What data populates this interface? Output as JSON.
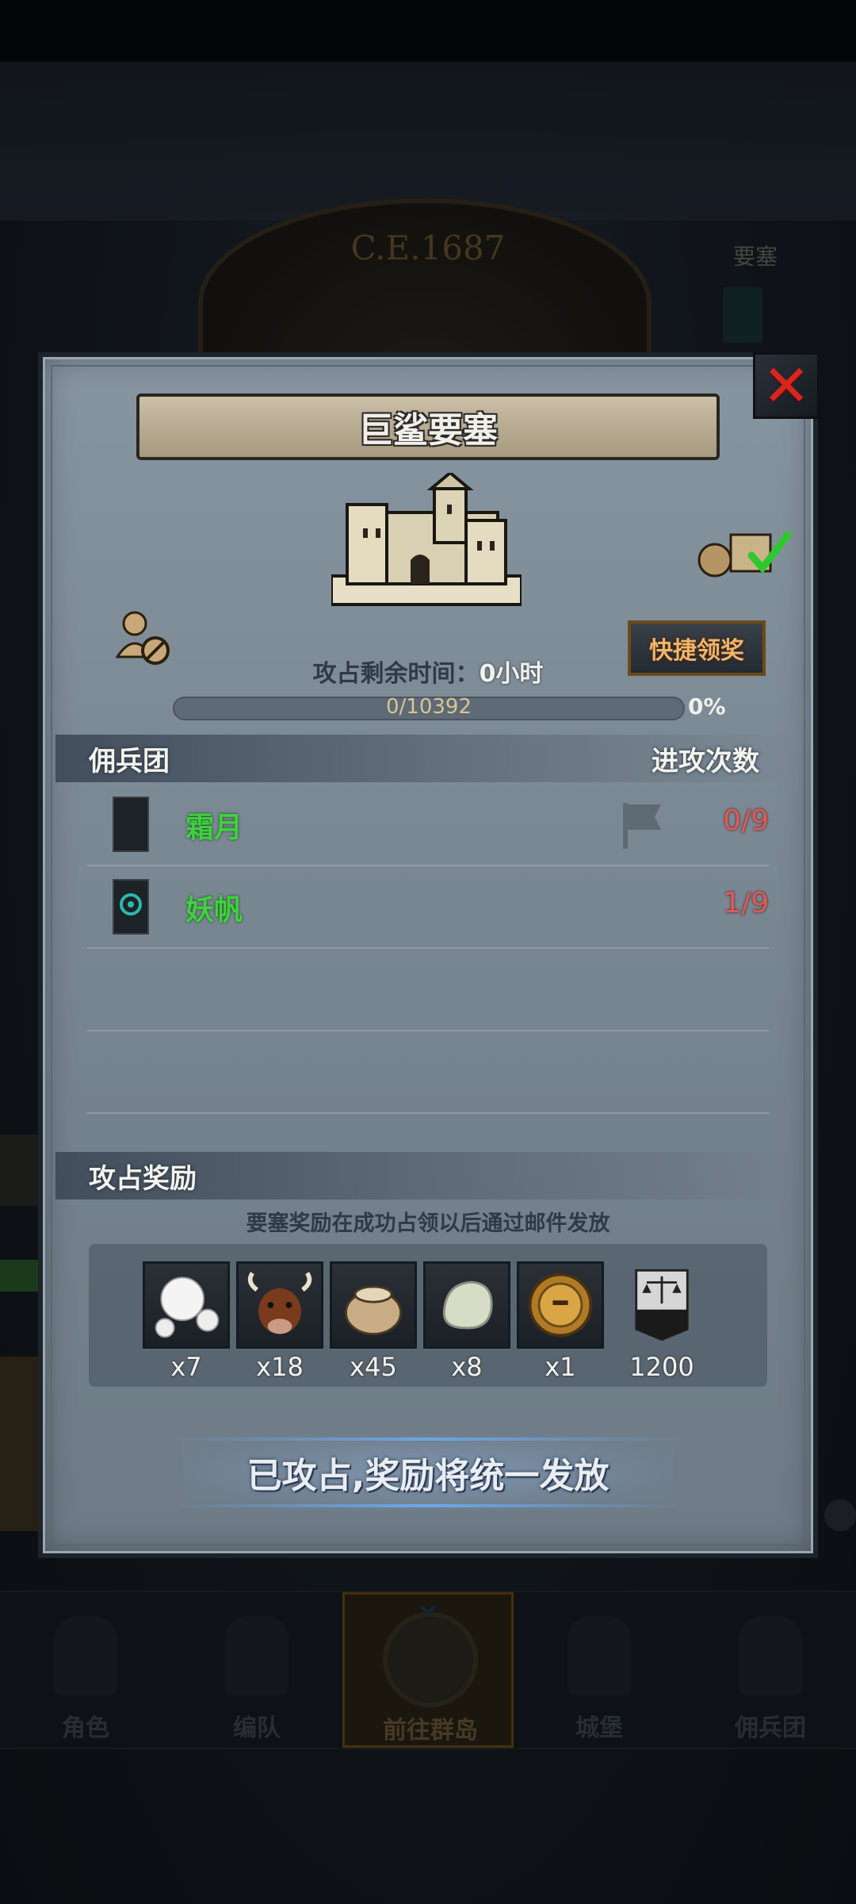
{
  "background": {
    "era_text": "C.E.1687",
    "fortress_tag": "要塞"
  },
  "bottom_nav": {
    "items": [
      {
        "label": "角色",
        "icon": "knight-icon"
      },
      {
        "label": "编队",
        "icon": "horse-knight-icon"
      },
      {
        "label": "前往群岛",
        "icon": "compass-icon",
        "active": true
      },
      {
        "label": "城堡",
        "icon": "castle-icon"
      },
      {
        "label": "佣兵团",
        "icon": "ship-icon"
      }
    ]
  },
  "dialog": {
    "title": "巨鲨要塞",
    "quick_claim_label": "快捷领奖",
    "time_label": "攻占剩余时间：",
    "time_value": "0小时",
    "progress": {
      "text": "0/10392",
      "percent_text": "0%",
      "fraction": 0.0
    },
    "mercenary_section": {
      "left_label": "佣兵团",
      "right_label": "进攻次数",
      "rows": [
        {
          "name": "霜月",
          "count": "0/9",
          "banner_icon": "crescent-moon-banner-icon",
          "show_flag": true
        },
        {
          "name": "妖帆",
          "count": "1/9",
          "banner_icon": "teal-eye-banner-icon",
          "show_flag": false
        }
      ]
    },
    "rewards_section": {
      "label": "攻占奖励",
      "note": "要塞奖励在成功占领以后通过邮件发放",
      "items": [
        {
          "icon": "pearl-icon",
          "qty": "x7"
        },
        {
          "icon": "ox-icon",
          "qty": "x18"
        },
        {
          "icon": "grain-sack-icon",
          "qty": "x45"
        },
        {
          "icon": "jade-stone-icon",
          "qty": "x8"
        },
        {
          "icon": "golden-helmet-icon",
          "qty": "x1"
        },
        {
          "icon": "justice-scale-banner-icon",
          "qty": "1200"
        }
      ]
    },
    "captured_message": "已攻占,奖励将统一发放"
  },
  "colors": {
    "merc_name": "#3ed23e",
    "attack_count": "#e05a55",
    "close_x": "#d9261d",
    "quick_claim_text": "#f0b46a"
  }
}
